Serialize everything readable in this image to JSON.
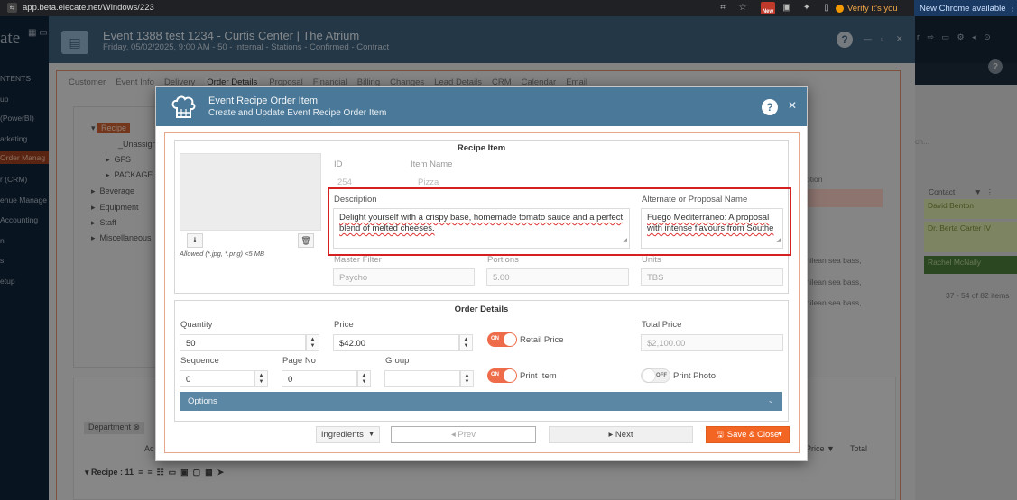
{
  "browser": {
    "url": "app.beta.elecate.net/Windows/223",
    "new_badge": "New",
    "verify_label": "Verify it's you",
    "new_chrome_label": "New Chrome available"
  },
  "app_sidebar": {
    "logo": "ate",
    "items": [
      "NTENTS",
      "up",
      "(PowerBI)",
      "arketing",
      "Order Manag",
      "r (CRM)",
      "enue Manage",
      "Accounting",
      "n",
      "s",
      "etup"
    ]
  },
  "event": {
    "title": "Event 1388 test 1234 - Curtis Center | The Atrium",
    "subtitle": "Friday, 05/02/2025, 9:00 AM - 50 - Internal - Stations - Confirmed - Contract",
    "tabs": [
      "Customer",
      "Event Info",
      "Delivery",
      "Order Details",
      "Proposal",
      "Financial",
      "Billing",
      "Changes",
      "Lead Details",
      "CRM",
      "Calendar",
      "Email"
    ],
    "active_tab": "Order Details"
  },
  "tree": {
    "recipe": "Recipe",
    "unassigned": "_Unassign",
    "gfs": "GFS",
    "package": "PACKAGE",
    "beverage": "Beverage",
    "equipment": "Equipment",
    "staff": "Staff",
    "misc": "Miscellaneous"
  },
  "background_lower": {
    "department_chip": "Department",
    "ac": "Ac",
    "recipe_group": "Recipe : 11",
    "price_col": "Price",
    "total_col": "Total"
  },
  "background_rows": [
    "ption",
    "hilean sea bass,",
    "hilean sea bass,",
    "hilean sea bass,"
  ],
  "right_panel": {
    "search_placeholder": "ch...",
    "contact_header": "Contact",
    "contacts": [
      "David Benton",
      "Dr. Berta Carter IV",
      "Rachel McNally"
    ],
    "pager": "37 - 54 of 82 items"
  },
  "modal": {
    "title": "Event Recipe Order Item",
    "subtitle": "Create and Update Event Recipe Order Item",
    "recipe_item": {
      "section_title": "Recipe Item",
      "allowed_text": "Allowed (*.jpg, *.png) <5 MB",
      "id_label": "ID",
      "id_value": "254",
      "item_name_label": "Item Name",
      "item_name_value": "Pizza",
      "description_label": "Description",
      "description_value": "Delight yourself with a crispy base, homemade tomato sauce and a perfect blend of melted cheeses.",
      "alt_name_label": "Alternate or Proposal Name",
      "alt_name_value": "Fuego Mediterráneo: A proposal with intense flavours from Southe",
      "master_filter_label": "Master Filter",
      "master_filter_value": "Psycho",
      "portions_label": "Portions",
      "portions_value": "5.00",
      "units_label": "Units",
      "units_value": "TBS"
    },
    "order_details": {
      "section_title": "Order Details",
      "quantity_label": "Quantity",
      "quantity_value": "50",
      "price_label": "Price",
      "price_value": "$42.00",
      "retail_price_label": "Retail Price",
      "retail_toggle": "ON",
      "total_price_label": "Total Price",
      "total_price_value": "$2,100.00",
      "sequence_label": "Sequence",
      "sequence_value": "0",
      "page_no_label": "Page No",
      "page_no_value": "0",
      "group_label": "Group",
      "group_value": "",
      "print_item_label": "Print Item",
      "print_item_toggle": "ON",
      "print_photo_label": "Print Photo",
      "print_photo_toggle": "OFF",
      "options_label": "Options"
    },
    "footer": {
      "ingredients": "Ingredients",
      "prev": "◂ Prev",
      "next": "▸ Next",
      "save_close": "Save & Close"
    }
  },
  "colors": {
    "accent": "#f26522",
    "header": "#4a7898",
    "highlight_box": "#d62020",
    "toggle_on": "#ef6c4a"
  }
}
